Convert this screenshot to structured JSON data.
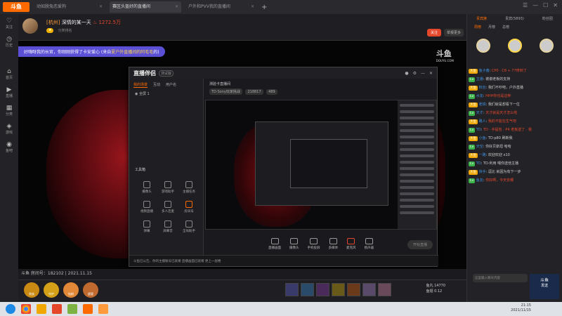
{
  "browser": {
    "logo": "斗鱼",
    "tabs": [
      {
        "label": "动如脱兔恋爱狗"
      },
      {
        "label": "赛区头盔好的直播间"
      },
      {
        "label": "户外和PVV我的直播间"
      }
    ]
  },
  "leftnav": [
    {
      "label": "关注",
      "icon": "heart-icon"
    },
    {
      "label": "历史",
      "icon": "history-icon"
    },
    {
      "label": "首页",
      "icon": "home-icon"
    },
    {
      "label": "直播",
      "icon": "live-icon"
    },
    {
      "label": "分类",
      "icon": "grid-icon"
    },
    {
      "label": "游戏",
      "icon": "game-icon"
    },
    {
      "label": "鱼吧",
      "icon": "fish-icon"
    }
  ],
  "room": {
    "city": "[杭州]",
    "title": "深情的某一天",
    "heat": "1272.5万",
    "follow_label": "关注",
    "more_label": "举报更多",
    "rank_text": "分类排名",
    "room_number_label": "斗鱼 房间号：182102 | 2021.11.15"
  },
  "notice": {
    "text": "好嗨呀我的长官，你刚刚获得了卡安爱心 (来自",
    "highlight": "夏户外直播间的阿毛毛",
    "suffix": "的)"
  },
  "watermark": {
    "text": "斗鱼",
    "sub": "DOUYU.COM"
  },
  "app": {
    "logo": "直播伴侣",
    "version": "测试版",
    "side_tabs": [
      "我的场景",
      "互动",
      "用户名"
    ],
    "scene_row": "全屏 1",
    "tools_title": "工具箱",
    "tools": [
      "摄像头",
      "游戏助手",
      "主播任务",
      "视频直播",
      "多人连麦",
      "房间号",
      "弹幕",
      "屏幕音",
      "全局助手",
      "互动玩法",
      "房间管理",
      "更多"
    ],
    "room_name": "测验卡直播间",
    "room_sub_pills": [
      "TD·Sony玩家挑战",
      "218817",
      "489"
    ],
    "bottom_items": [
      "直播画面",
      "摄像头",
      "手机投屏",
      "多媒体",
      "麦克风",
      "扬声器"
    ],
    "start_label": "开始直播",
    "status_text": "斗鱼已公告，你的主播账号已就绪  直播画面已就绪  更上一层楼"
  },
  "gift_bar": {
    "ranks": [
      "贵族",
      "守护",
      "钻粉",
      "超管",
      "弹幕"
    ],
    "balance_label": "鱼丸",
    "balance": "14770",
    "yuchi_label": "鱼翅",
    "yuchi": "0.12"
  },
  "chat": {
    "tabs": [
      "贵宾席",
      "贵宾(5893)",
      "粉丝团"
    ],
    "sub_tabs": [
      "周榜",
      "月榜",
      "总榜"
    ],
    "messages": [
      {
        "user": "鱼子酱",
        "text": "CP0 · C8 + 77修到了"
      },
      {
        "user": "主播",
        "text": "谢谢老板的支持"
      },
      {
        "user": "粉丝",
        "text": "我们不吵吧，户外直播"
      },
      {
        "user": "水友",
        "text": "HHH你也是这种"
      },
      {
        "user": "老铁",
        "text": "我们就是想看下一位"
      },
      {
        "user": "天才",
        "text": "天才就是天才怎么啦"
      },
      {
        "user": "路人",
        "text": "我的不能在生气吧"
      },
      {
        "user": "TD",
        "text": "TD · 手提包 · P4 老板送了 · 我"
      },
      {
        "user": "小鱼",
        "text": "TD·p80 刷新我"
      },
      {
        "user": "天空",
        "text": "你好贝斯坦 哈哈"
      },
      {
        "user": "一路",
        "text": "欢迎欢迎 x10"
      },
      {
        "user": "TD",
        "text": "TD·利用 喂你送他主播"
      },
      {
        "user": "快手",
        "text": "逗比 就因为有下一步"
      },
      {
        "user": "鱼友",
        "text": "你好啊，今天去哪"
      }
    ],
    "input_placeholder": "这里输入聊天内容",
    "send_label": "斗鱼",
    "send_sub": "发送"
  },
  "taskbar": {
    "time": "21:15",
    "date": "2021/11/15"
  }
}
